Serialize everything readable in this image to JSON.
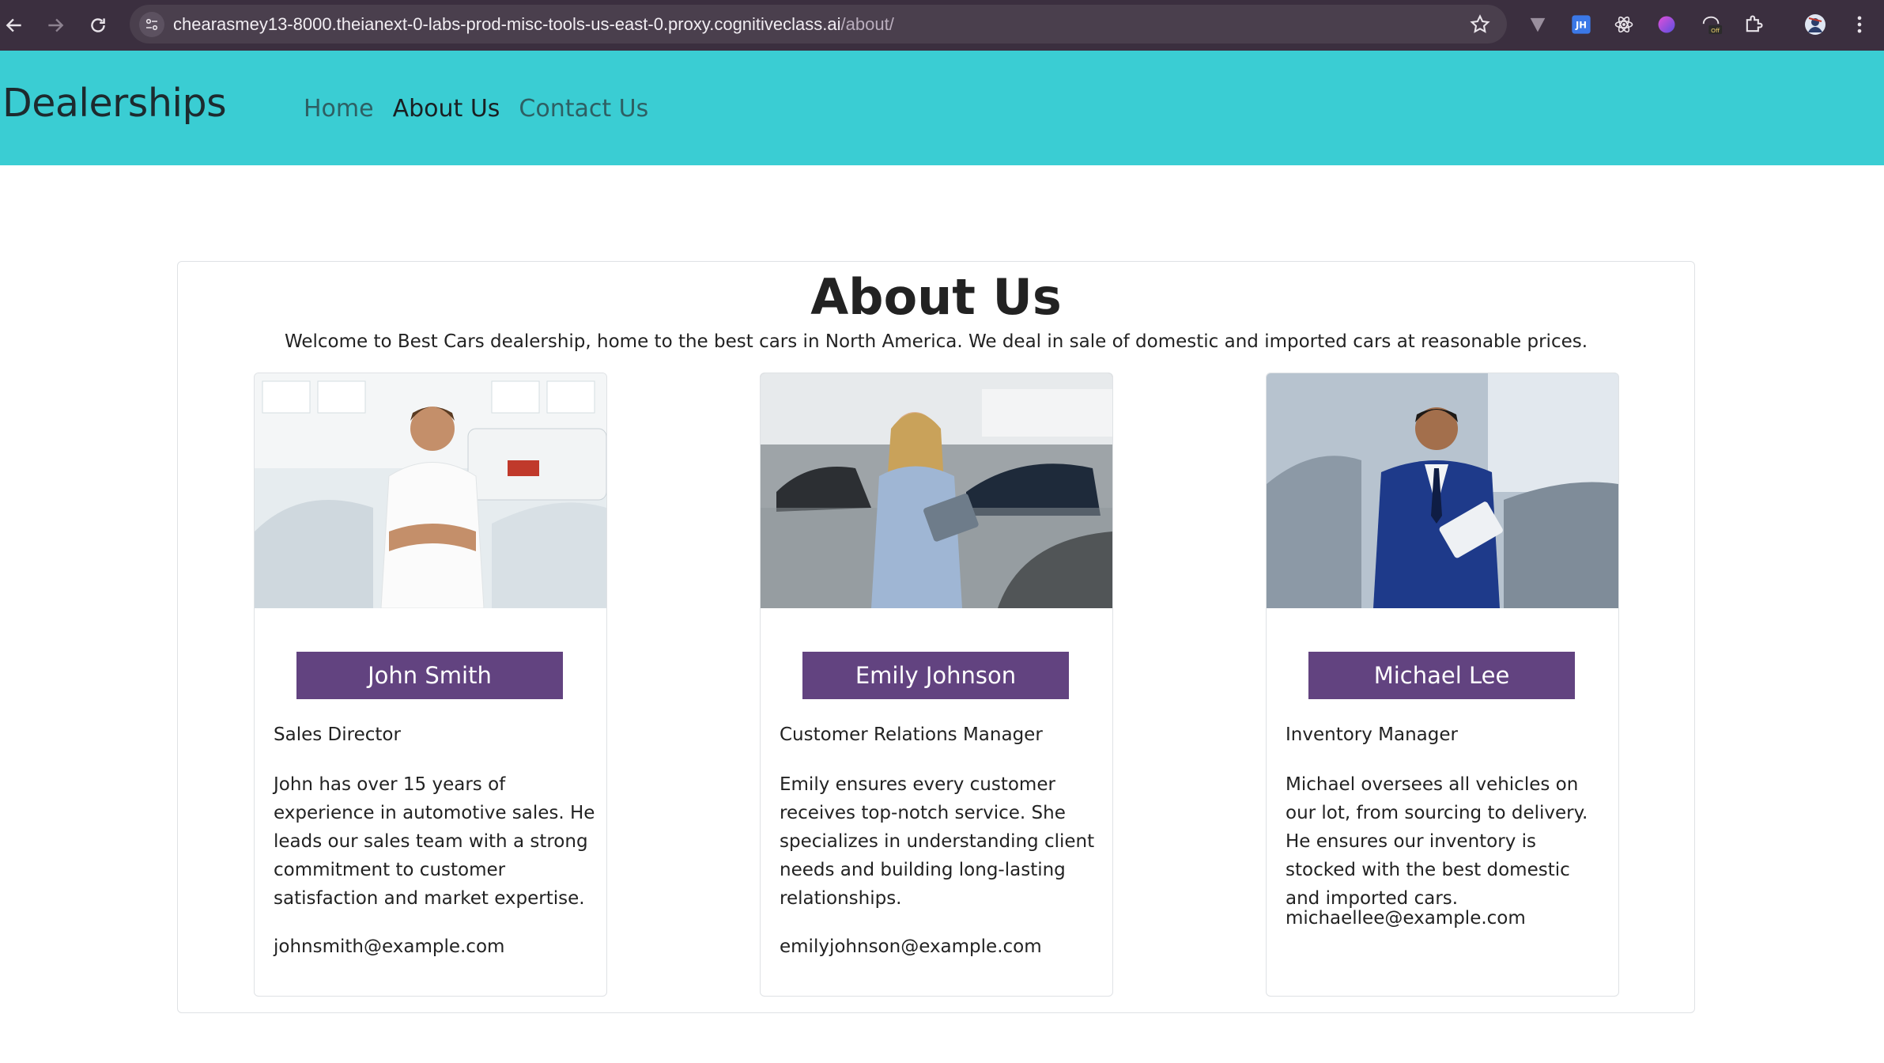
{
  "browser": {
    "url_host": "chearasmey13-8000.theianext-0-labs-prod-misc-tools-us-east-0.proxy.cognitiveclass.ai",
    "url_path": "/about/",
    "icons": [
      "back-icon",
      "forward-icon",
      "reload-icon",
      "site-info-icon",
      "bookmark-star-icon",
      "extension-v-icon",
      "extension-jh-icon",
      "extension-react-icon",
      "extension-orb-icon",
      "extension-off-icon",
      "extensions-puzzle-icon",
      "profile-avatar-icon",
      "menu-kebab-icon"
    ],
    "ext_jh_label": "JH",
    "ext_off_label": "Off"
  },
  "navbar": {
    "brand": "Dealerships",
    "links": [
      {
        "label": "Home"
      },
      {
        "label": "About Us"
      },
      {
        "label": "Contact Us"
      }
    ],
    "active_index": 1,
    "background": "#3acdd3"
  },
  "about": {
    "title": "About Us",
    "intro": "Welcome to Best Cars dealership, home to the best cars in North America. We deal in sale of domestic and imported cars at reasonable prices.",
    "members": [
      {
        "name": "John Smith",
        "role": "Sales Director",
        "bio": "John has over 15 years of experience in automotive sales. He leads our sales team with a strong commitment to customer satisfaction and market expertise.",
        "email": "johnsmith@example.com"
      },
      {
        "name": "Emily Johnson",
        "role": "Customer Relations Manager",
        "bio": "Emily ensures every customer receives top-notch service. She specializes in understanding client needs and building long-lasting relationships.",
        "email": "emilyjohnson@example.com"
      },
      {
        "name": "Michael Lee",
        "role": "Inventory Manager",
        "bio": "Michael oversees all vehicles on our lot, from sourcing to delivery. He ensures our inventory is stocked with the best domestic and imported cars.",
        "email": "michaellee@example.com"
      }
    ],
    "name_badge_color": "#624380"
  }
}
